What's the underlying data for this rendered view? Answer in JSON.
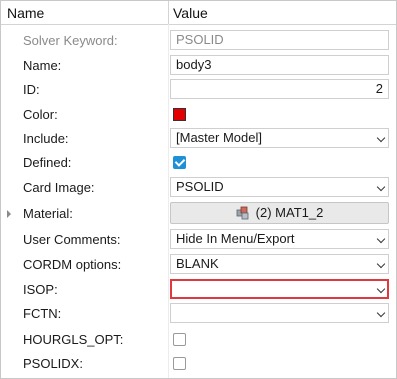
{
  "header": {
    "name_col": "Name",
    "value_col": "Value"
  },
  "rows": {
    "solver_keyword": {
      "label": "Solver Keyword:",
      "value": "PSOLID"
    },
    "name": {
      "label": "Name:",
      "value": "body3"
    },
    "id": {
      "label": "ID:",
      "value": "2"
    },
    "color": {
      "label": "Color:",
      "swatch": "#e20000"
    },
    "include": {
      "label": "Include:",
      "value": "[Master Model]"
    },
    "defined": {
      "label": "Defined:",
      "checked": true
    },
    "card_image": {
      "label": "Card Image:",
      "value": "PSOLID"
    },
    "material": {
      "label": "Material:",
      "value": "(2) MAT1_2",
      "icon": "material-icon"
    },
    "user_comments": {
      "label": "User Comments:",
      "value": "Hide In Menu/Export"
    },
    "cordm_options": {
      "label": "CORDM options:",
      "value": "BLANK"
    },
    "isop": {
      "label": "ISOP:",
      "value": "",
      "highlight_color": "#e0383e"
    },
    "fctn": {
      "label": "FCTN:",
      "value": ""
    },
    "hourgls_opt": {
      "label": "HOURGLS_OPT:",
      "checked": false
    },
    "psolidx": {
      "label": "PSOLIDX:",
      "checked": false
    }
  }
}
